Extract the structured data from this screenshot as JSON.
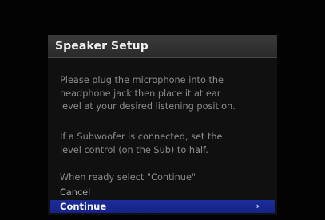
{
  "dialog": {
    "title": "Speaker Setup",
    "paragraphs": [
      "Please plug the microphone into the\nheadphone jack then place it at ear\nlevel at your desired listening position.",
      "If a Subwoofer is connected, set the\nlevel control (on the Sub) to half.",
      "When ready select \"Continue\""
    ],
    "options": {
      "cancel_label": "Cancel",
      "continue_label": "Continue"
    },
    "icons": {
      "selected_arrow": "›"
    },
    "colors": {
      "highlight": "#1c2c9a",
      "title_bar": "#333333",
      "text": "#8c8c8c"
    }
  }
}
